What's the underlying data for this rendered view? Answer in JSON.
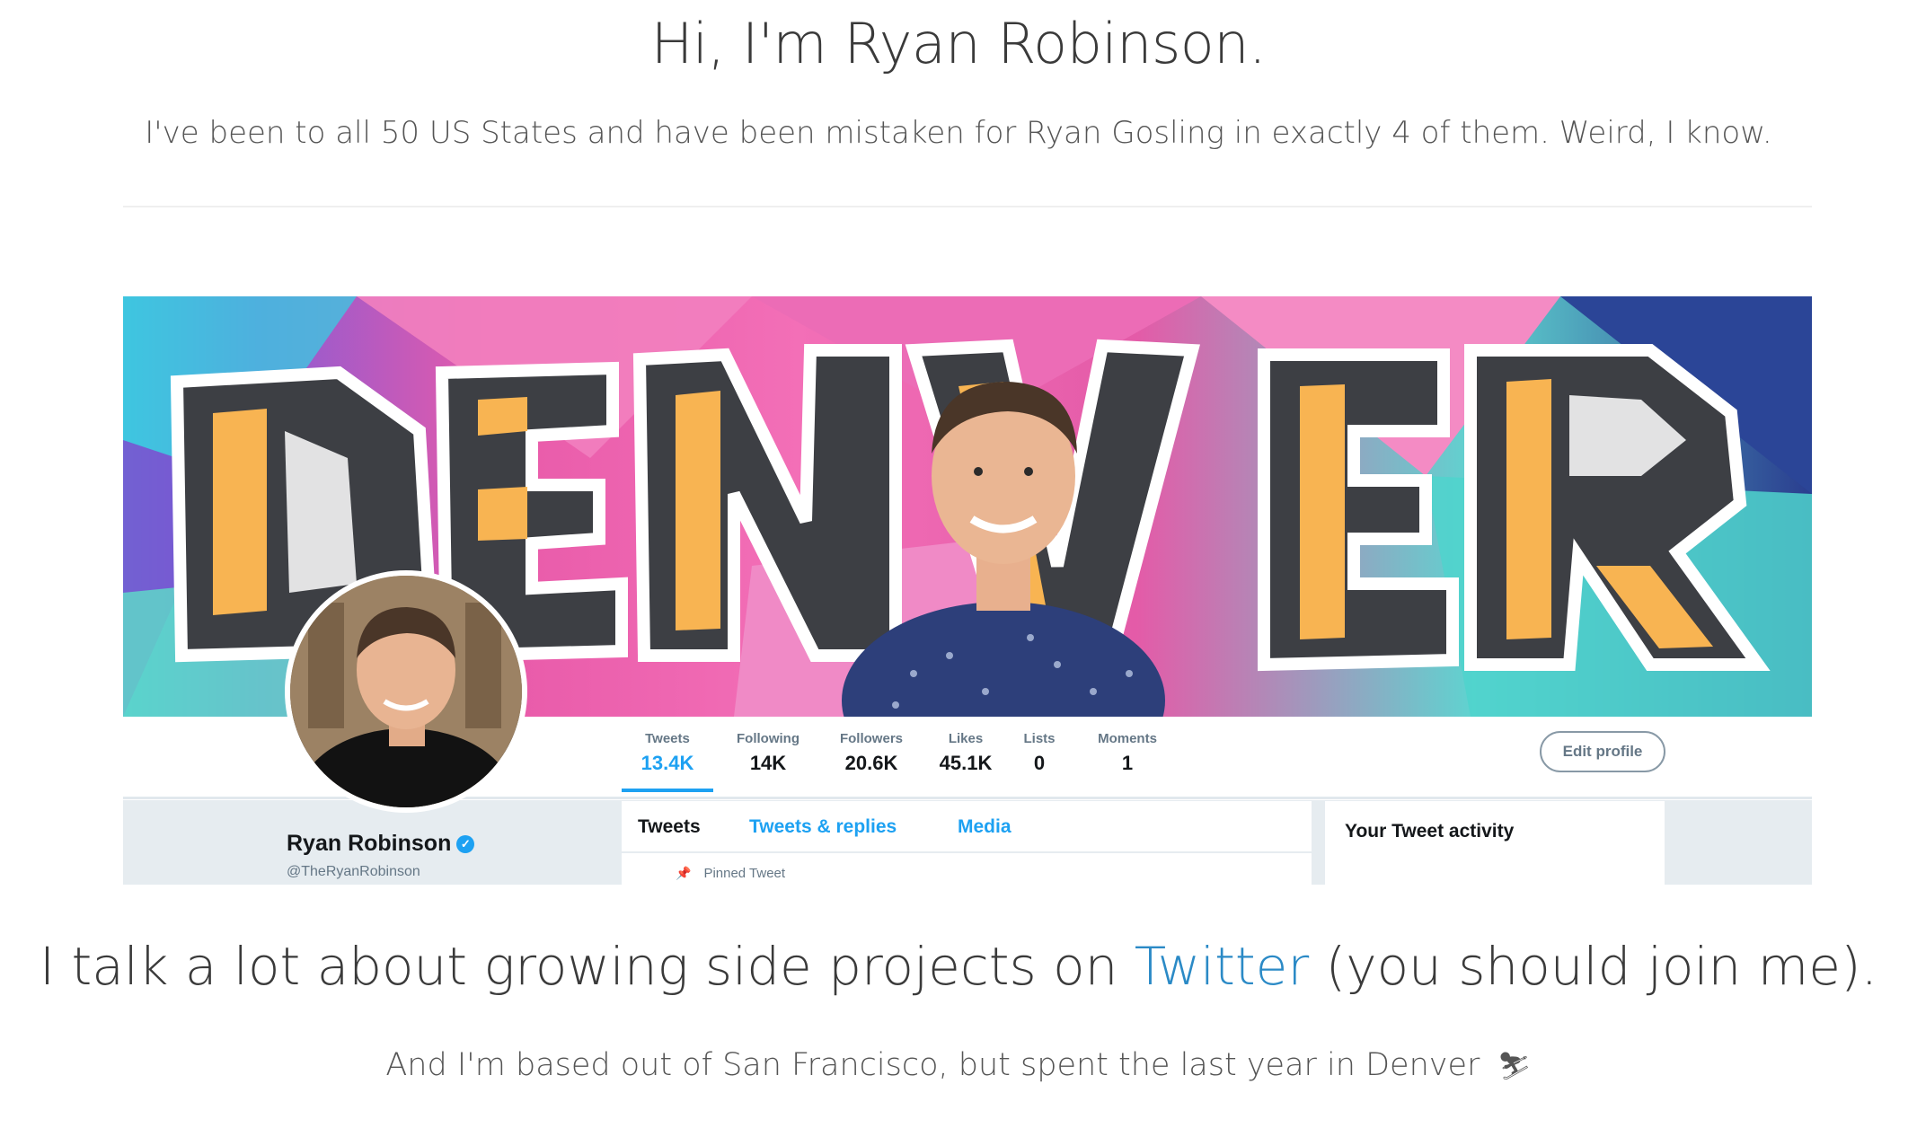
{
  "hero": {
    "title": "Hi, I'm Ryan Robinson.",
    "subtitle": "I've been to all 50 US States and have been mistaken for Ryan Gosling in exactly 4 of them. Weird, I know."
  },
  "twitter_profile": {
    "banner_text": "DENVER",
    "stats": [
      {
        "label": "Tweets",
        "value": "13.4K"
      },
      {
        "label": "Following",
        "value": "14K"
      },
      {
        "label": "Followers",
        "value": "20.6K"
      },
      {
        "label": "Likes",
        "value": "45.1K"
      },
      {
        "label": "Lists",
        "value": "0"
      },
      {
        "label": "Moments",
        "value": "1"
      }
    ],
    "edit_profile_label": "Edit profile",
    "name": "Ryan Robinson",
    "handle": "@TheRyanRobinson",
    "tabs": [
      "Tweets",
      "Tweets & replies",
      "Media"
    ],
    "pinned_label": "Pinned Tweet",
    "activity_title": "Your Tweet activity",
    "colors": {
      "accent": "#1da1f2",
      "background": "#e6ecf0"
    }
  },
  "tagline": {
    "before": "I talk a lot about growing side projects on ",
    "link": "Twitter",
    "after": " (you should join me)."
  },
  "location": {
    "text": "And I'm based out of San Francisco, but spent the last year in Denver",
    "icon": "skier-icon"
  }
}
